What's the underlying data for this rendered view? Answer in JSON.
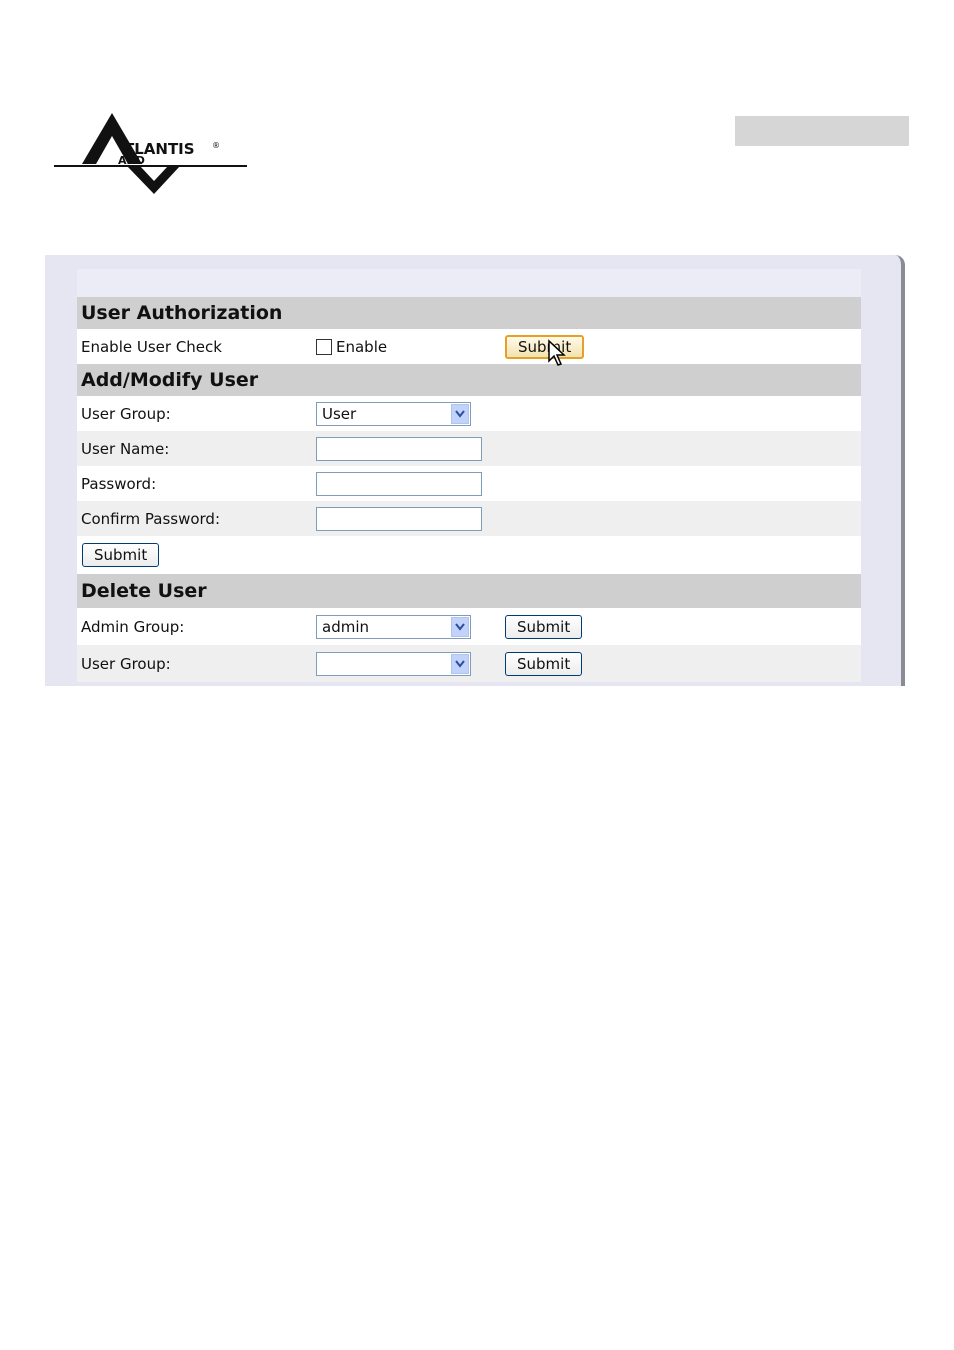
{
  "header": {
    "logo": {
      "icon": "atlantis-land-logo",
      "text_main": "TLANTIS",
      "text_sub": "AND",
      "trademark": "®"
    }
  },
  "user_authorization": {
    "title": "User Authorization",
    "enable_user_check_label": "Enable User Check",
    "enable_checkbox_label": "Enable",
    "enable_checked": false,
    "submit_label": "Submit"
  },
  "add_modify_user": {
    "title": "Add/Modify User",
    "user_group_label": "User Group:",
    "user_group_value": "User",
    "user_name_label": "User Name:",
    "user_name_value": "",
    "password_label": "Password:",
    "password_value": "",
    "confirm_password_label": "Confirm Password:",
    "confirm_password_value": "",
    "submit_label": "Submit"
  },
  "delete_user": {
    "title": "Delete User",
    "admin_group_label": "Admin Group:",
    "admin_group_value": "admin",
    "admin_submit_label": "Submit",
    "user_group_label": "User Group:",
    "user_group_value": "",
    "user_submit_label": "Submit"
  }
}
